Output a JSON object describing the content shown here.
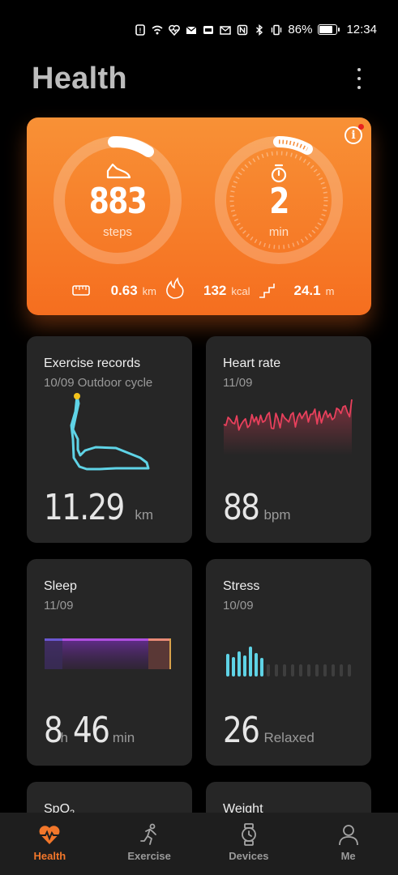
{
  "status_bar": {
    "battery_percent": "86%",
    "battery_level": 0.86,
    "time": "12:34"
  },
  "header": {
    "title": "Health"
  },
  "activity": {
    "steps_value": "883",
    "steps_unit": "steps",
    "minutes_value": "2",
    "minutes_unit": "min",
    "distance_value": "0.63",
    "distance_unit": "km",
    "calories_value": "132",
    "calories_unit": "kcal",
    "climb_value": "24.1",
    "climb_unit": "m"
  },
  "tiles": {
    "exercise": {
      "title": "Exercise records",
      "subtitle": "10/09 Outdoor cycle",
      "value": "11.29",
      "unit": "km"
    },
    "heart_rate": {
      "title": "Heart rate",
      "subtitle": "11/09",
      "value": "88",
      "unit": "bpm"
    },
    "sleep": {
      "title": "Sleep",
      "subtitle": "11/09",
      "hours": "8",
      "hours_unit": "h",
      "minutes": "46",
      "minutes_unit": "min"
    },
    "stress": {
      "title": "Stress",
      "subtitle": "10/09",
      "value": "26",
      "label": "Relaxed"
    },
    "spo2": {
      "title": "SpO",
      "title_sub": "2"
    },
    "weight": {
      "title": "Weight"
    }
  },
  "nav": [
    {
      "label": "Health",
      "icon": "heart-pulse-icon",
      "active": true
    },
    {
      "label": "Exercise",
      "icon": "running-icon",
      "active": false
    },
    {
      "label": "Devices",
      "icon": "watch-icon",
      "active": false
    },
    {
      "label": "Me",
      "icon": "person-icon",
      "active": false
    }
  ],
  "colors": {
    "accent": "#f2772b",
    "card_orange": "#f67f2a",
    "tile_bg": "#262626",
    "heart_line": "#e8405c",
    "route_line": "#5fd3e6",
    "stress_bar": "#5fd3e6",
    "sleep_bar": "#8a3fc4"
  }
}
